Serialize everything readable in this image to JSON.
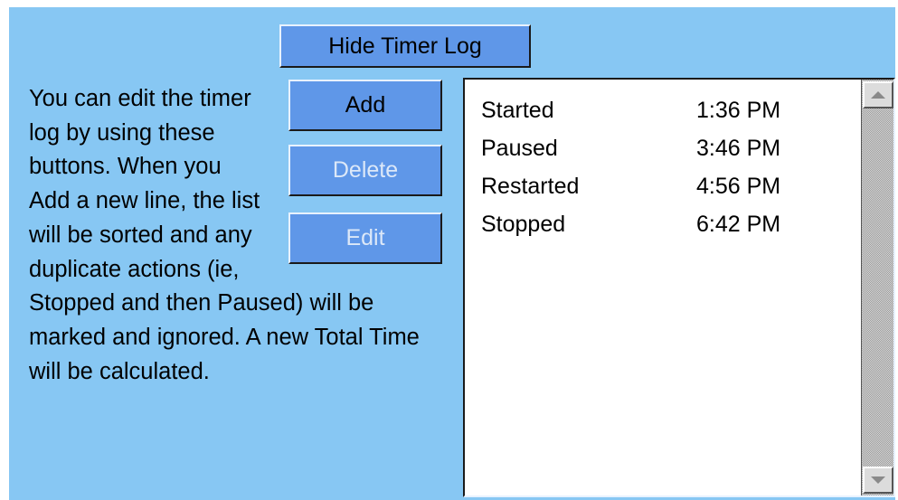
{
  "toolbar": {
    "hide_timer_log_label": "Hide Timer Log",
    "add_label": "Add",
    "delete_label": "Delete",
    "edit_label": "Edit",
    "delete_enabled": false,
    "edit_enabled": false
  },
  "help": {
    "text": "You can edit the timer log by using these buttons. When you Add a new line, the list will be sorted and any duplicate actions (ie, Stopped and then Paused) will be marked and ignored. A new Total Time will be calculated."
  },
  "timer_log": {
    "entries": [
      {
        "action": "Started",
        "time": "1:36 PM"
      },
      {
        "action": "Paused",
        "time": "3:46 PM"
      },
      {
        "action": "Restarted",
        "time": "4:56 PM"
      },
      {
        "action": "Stopped",
        "time": "6:42 PM"
      }
    ]
  },
  "colors": {
    "panel_background": "#87c7f3",
    "button_background": "#5f97e8",
    "disabled_text": "#dce8f8"
  },
  "icons": {
    "scroll_up": "triangle-up-icon",
    "scroll_down": "triangle-down-icon"
  }
}
